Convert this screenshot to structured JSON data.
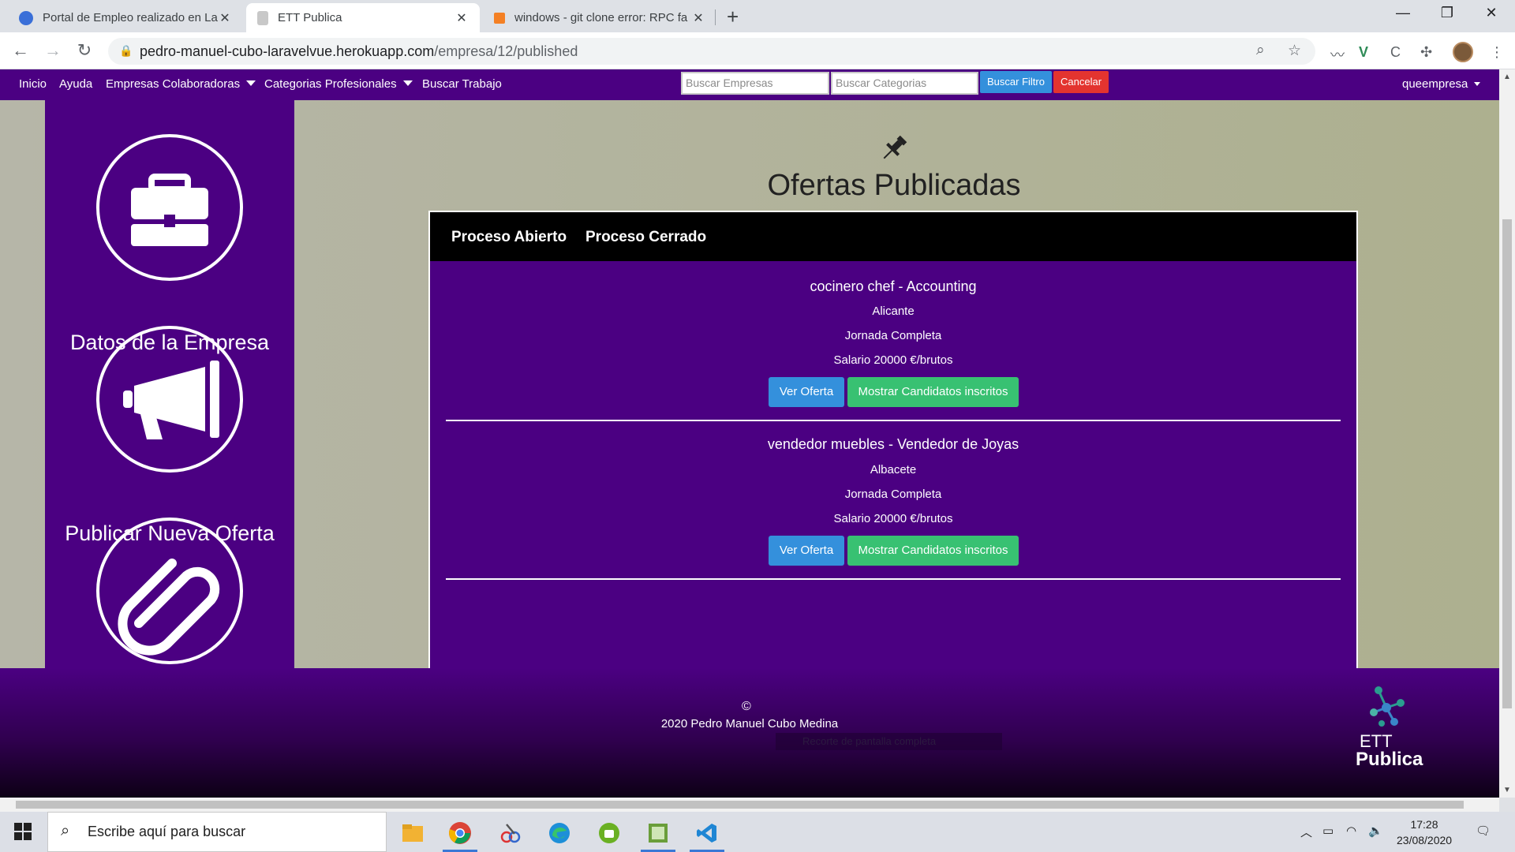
{
  "browser": {
    "tabs": [
      {
        "title": "Portal de Empleo realizado en La",
        "favicon_color": "#3a6fd8",
        "active": false
      },
      {
        "title": "ETT Publica",
        "favicon_color": "#b0b0b0",
        "active": true
      },
      {
        "title": "windows - git clone error: RPC fa",
        "favicon_color": "#f48024",
        "active": false
      }
    ],
    "url_host": "pedro-manuel-cubo-laravelvue.herokuapp.com",
    "url_path": "/empresa/12/published"
  },
  "navbar": {
    "links": [
      "Inicio",
      "Ayuda",
      "Empresas Colaboradoras",
      "Categorias Profesionales",
      "Buscar Trabajo"
    ],
    "search_companies_placeholder": "Buscar Empresas",
    "search_categories_placeholder": "Buscar Categorias",
    "filter_button": "Buscar Filtro",
    "cancel_button": "Cancelar",
    "user": "queempresa"
  },
  "sidebar": {
    "items": [
      {
        "label": "Datos de la Empresa",
        "icon": "briefcase-icon"
      },
      {
        "label": "Publicar Nueva Oferta",
        "icon": "megaphone-icon"
      },
      {
        "label": "",
        "icon": "paperclip-icon"
      }
    ]
  },
  "main": {
    "title": "Ofertas Publicadas",
    "tabs": [
      "Proceso Abierto",
      "Proceso Cerrado"
    ],
    "offers": [
      {
        "title": "cocinero chef - Accounting",
        "location": "Alicante",
        "schedule": "Jornada Completa",
        "salary": "Salario 20000 €/brutos",
        "view_button": "Ver Oferta",
        "candidates_button": "Mostrar Candidatos inscritos"
      },
      {
        "title": "vendedor muebles - Vendedor de Joyas",
        "location": "Albacete",
        "schedule": "Jornada Completa",
        "salary": "Salario 20000 €/brutos",
        "view_button": "Ver Oferta",
        "candidates_button": "Mostrar Candidatos inscritos"
      }
    ]
  },
  "footer": {
    "copyright_symbol": "©",
    "copyright": "2020 Pedro Manuel Cubo Medina",
    "ghost_text": "Recorte de pantalla completa",
    "logo_line1": "ETT",
    "logo_line2": "Publica"
  },
  "taskbar": {
    "search_placeholder": "Escribe aquí para buscar",
    "time": "17:28",
    "date": "23/08/2020"
  },
  "colors": {
    "brand_purple": "#4b0082",
    "button_blue": "#3490dc",
    "button_green": "#38c172",
    "button_red": "#e3342f"
  }
}
